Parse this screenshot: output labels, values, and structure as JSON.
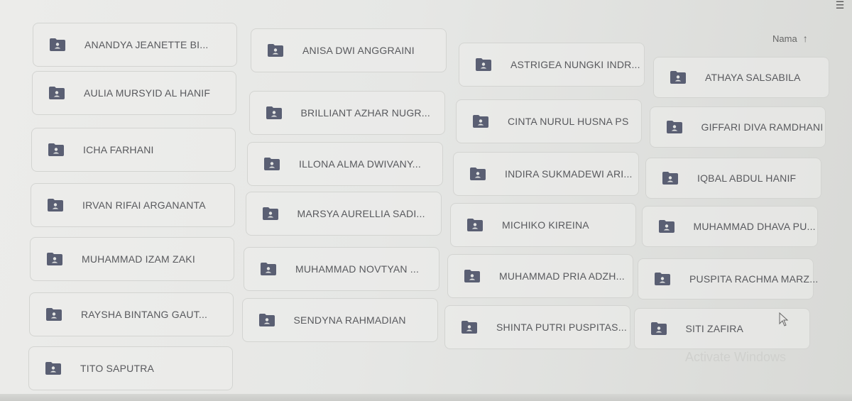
{
  "header": {
    "sort_label": "Nama",
    "sort_icon": "arrow-up-icon",
    "view_icon": "list-view-icon"
  },
  "folders": [
    "ANANDYA JEANETTE BI...",
    "ANISA DWI ANGGRAINI",
    "ASTRIGEA NUNGKI INDR...",
    "ATHAYA SALSABILA",
    "AULIA MURSYID AL HANIF",
    "BRILLIANT AZHAR NUGR...",
    "CINTA NURUL HUSNA PS",
    "GIFFARI DIVA RAMDHANI",
    "ICHA FARHANI",
    "ILLONA ALMA DWIVANY...",
    "INDIRA SUKMADEWI ARI...",
    "IQBAL ABDUL HANIF",
    "IRVAN RIFAI ARGANANTA",
    "MARSYA AURELLIA SADI...",
    "MICHIKO KIREINA",
    "MUHAMMAD DHAVA PU...",
    "MUHAMMAD IZAM ZAKI",
    "MUHAMMAD NOVTYAN ...",
    "MUHAMMAD PRIA ADZH...",
    "PUSPITA RACHMA MARZ...",
    "RAYSHA BINTANG GAUT...",
    "SENDYNA RAHMADIAN",
    "SHINTA PUTRI PUSPITAS...",
    "SITI ZAFIRA",
    "TITO SAPUTRA"
  ],
  "watermark": "Activate Windows",
  "colors": {
    "folder": "#5a5f73",
    "text": "#58595d"
  }
}
